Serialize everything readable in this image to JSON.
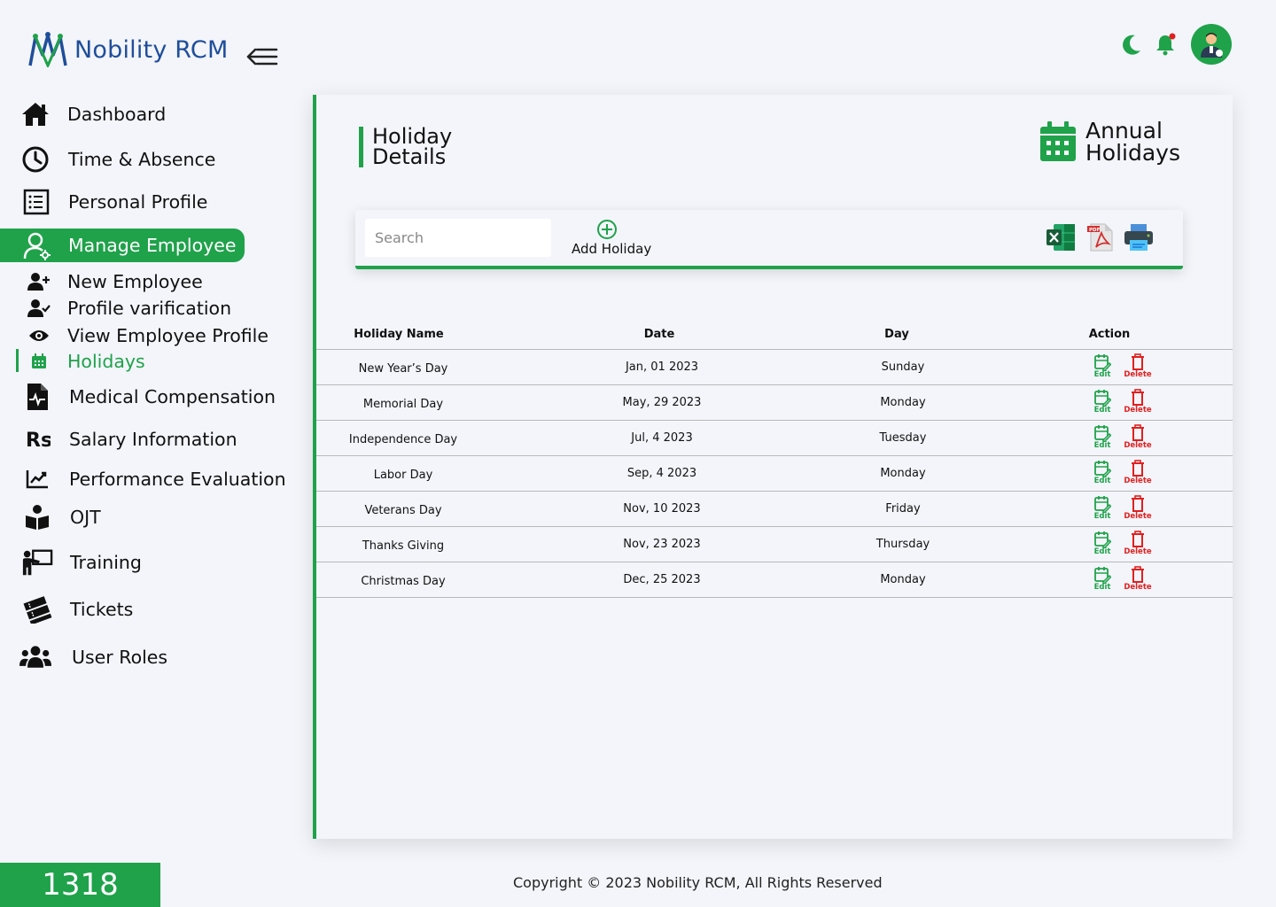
{
  "app": {
    "name": "Nobility RCM"
  },
  "sidebar": {
    "items": [
      {
        "label": "Dashboard",
        "icon": "home-icon"
      },
      {
        "label": "Time & Absence",
        "icon": "clock-icon"
      },
      {
        "label": "Personal Profile",
        "icon": "list-icon"
      },
      {
        "label": "Manage Employee",
        "icon": "user-manage-icon",
        "active": true
      },
      {
        "label": "Medical Compensation",
        "icon": "medical-file-icon"
      },
      {
        "label": "Salary Information",
        "icon": "rupee-icon"
      },
      {
        "label": "Performance Evaluation",
        "icon": "chart-line-icon"
      },
      {
        "label": "OJT",
        "icon": "book-reader-icon"
      },
      {
        "label": "Training",
        "icon": "teacher-board-icon"
      },
      {
        "label": "Tickets",
        "icon": "tickets-icon"
      },
      {
        "label": "User Roles",
        "icon": "users-icon"
      }
    ],
    "sub_items": [
      {
        "label": "New Employee",
        "icon": "user-plus-icon"
      },
      {
        "label": "Profile varification",
        "icon": "user-check-icon"
      },
      {
        "label": "View Employee Profile",
        "icon": "eye-icon"
      },
      {
        "label": "Holidays",
        "icon": "calendar-icon",
        "active": true
      }
    ]
  },
  "counter": "1318",
  "page": {
    "title": "Holiday Details",
    "annual": "Annual Holidays"
  },
  "toolbar": {
    "search_placeholder": "Search",
    "add_label": "Add Holiday"
  },
  "table": {
    "headers": [
      "Holiday Name",
      "Date",
      "Day",
      "Action"
    ],
    "rows": [
      {
        "name": "New Year’s Day",
        "date": "Jan, 01 2023",
        "day": "Sunday"
      },
      {
        "name": "Memorial Day",
        "date": "May, 29 2023",
        "day": "Monday"
      },
      {
        "name": "Independence Day",
        "date": "Jul, 4 2023",
        "day": "Tuesday"
      },
      {
        "name": "Labor Day",
        "date": "Sep, 4 2023",
        "day": "Monday"
      },
      {
        "name": "Veterans Day",
        "date": "Nov, 10 2023",
        "day": "Friday"
      },
      {
        "name": "Thanks Giving",
        "date": "Nov, 23 2023",
        "day": "Thursday"
      },
      {
        "name": "Christmas Day",
        "date": "Dec, 25 2023",
        "day": "Monday"
      }
    ],
    "edit_label": "Edit",
    "delete_label": "Delete"
  },
  "footer": "Copyright © 2023 Nobility RCM, All Rights Reserved",
  "colors": {
    "accent": "#1fa24a",
    "brand": "#1f4e9a",
    "danger": "#e02020",
    "background": "#f3f5fa"
  }
}
